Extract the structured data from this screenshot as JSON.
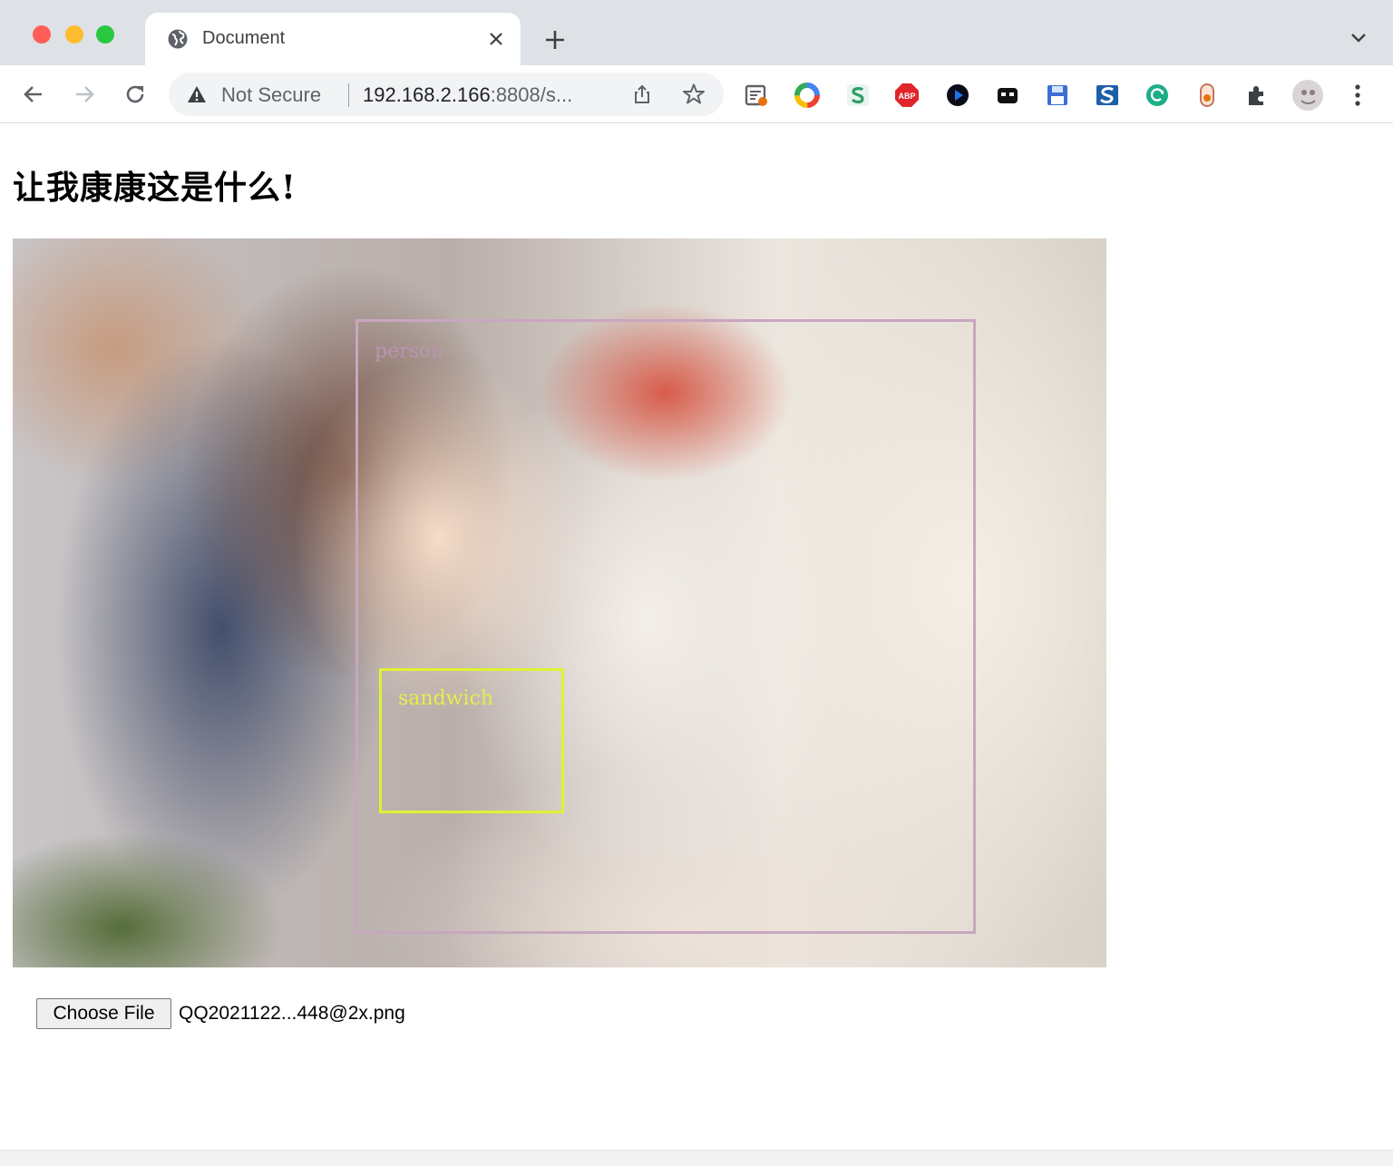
{
  "window": {
    "controls": [
      "close",
      "minimize",
      "maximize"
    ]
  },
  "tab": {
    "title": "Document",
    "favicon": "globe-icon"
  },
  "toolbar": {
    "security_label": "Not Secure",
    "url_host": "192.168.2.166",
    "url_rest": ":8808/s..."
  },
  "extensions": [
    "reader-mode-icon",
    "color-wheel-icon",
    "s-extension-icon",
    "adblock-plus-icon",
    "media-play-icon",
    "mask-icon",
    "save-disk-icon",
    "s-sync-icon",
    "refresh-circle-icon",
    "capsule-icon",
    "puzzle-piece-icon",
    "profile-avatar-icon"
  ],
  "page": {
    "heading": "让我康康这是什么!",
    "detections": [
      {
        "label": "person",
        "color": "#c9a6bf"
      },
      {
        "label": "sandwich",
        "color": "#dff233"
      }
    ],
    "file_input": {
      "button_label": "Choose File",
      "file_name": "QQ2021122...448@2x.png"
    }
  }
}
